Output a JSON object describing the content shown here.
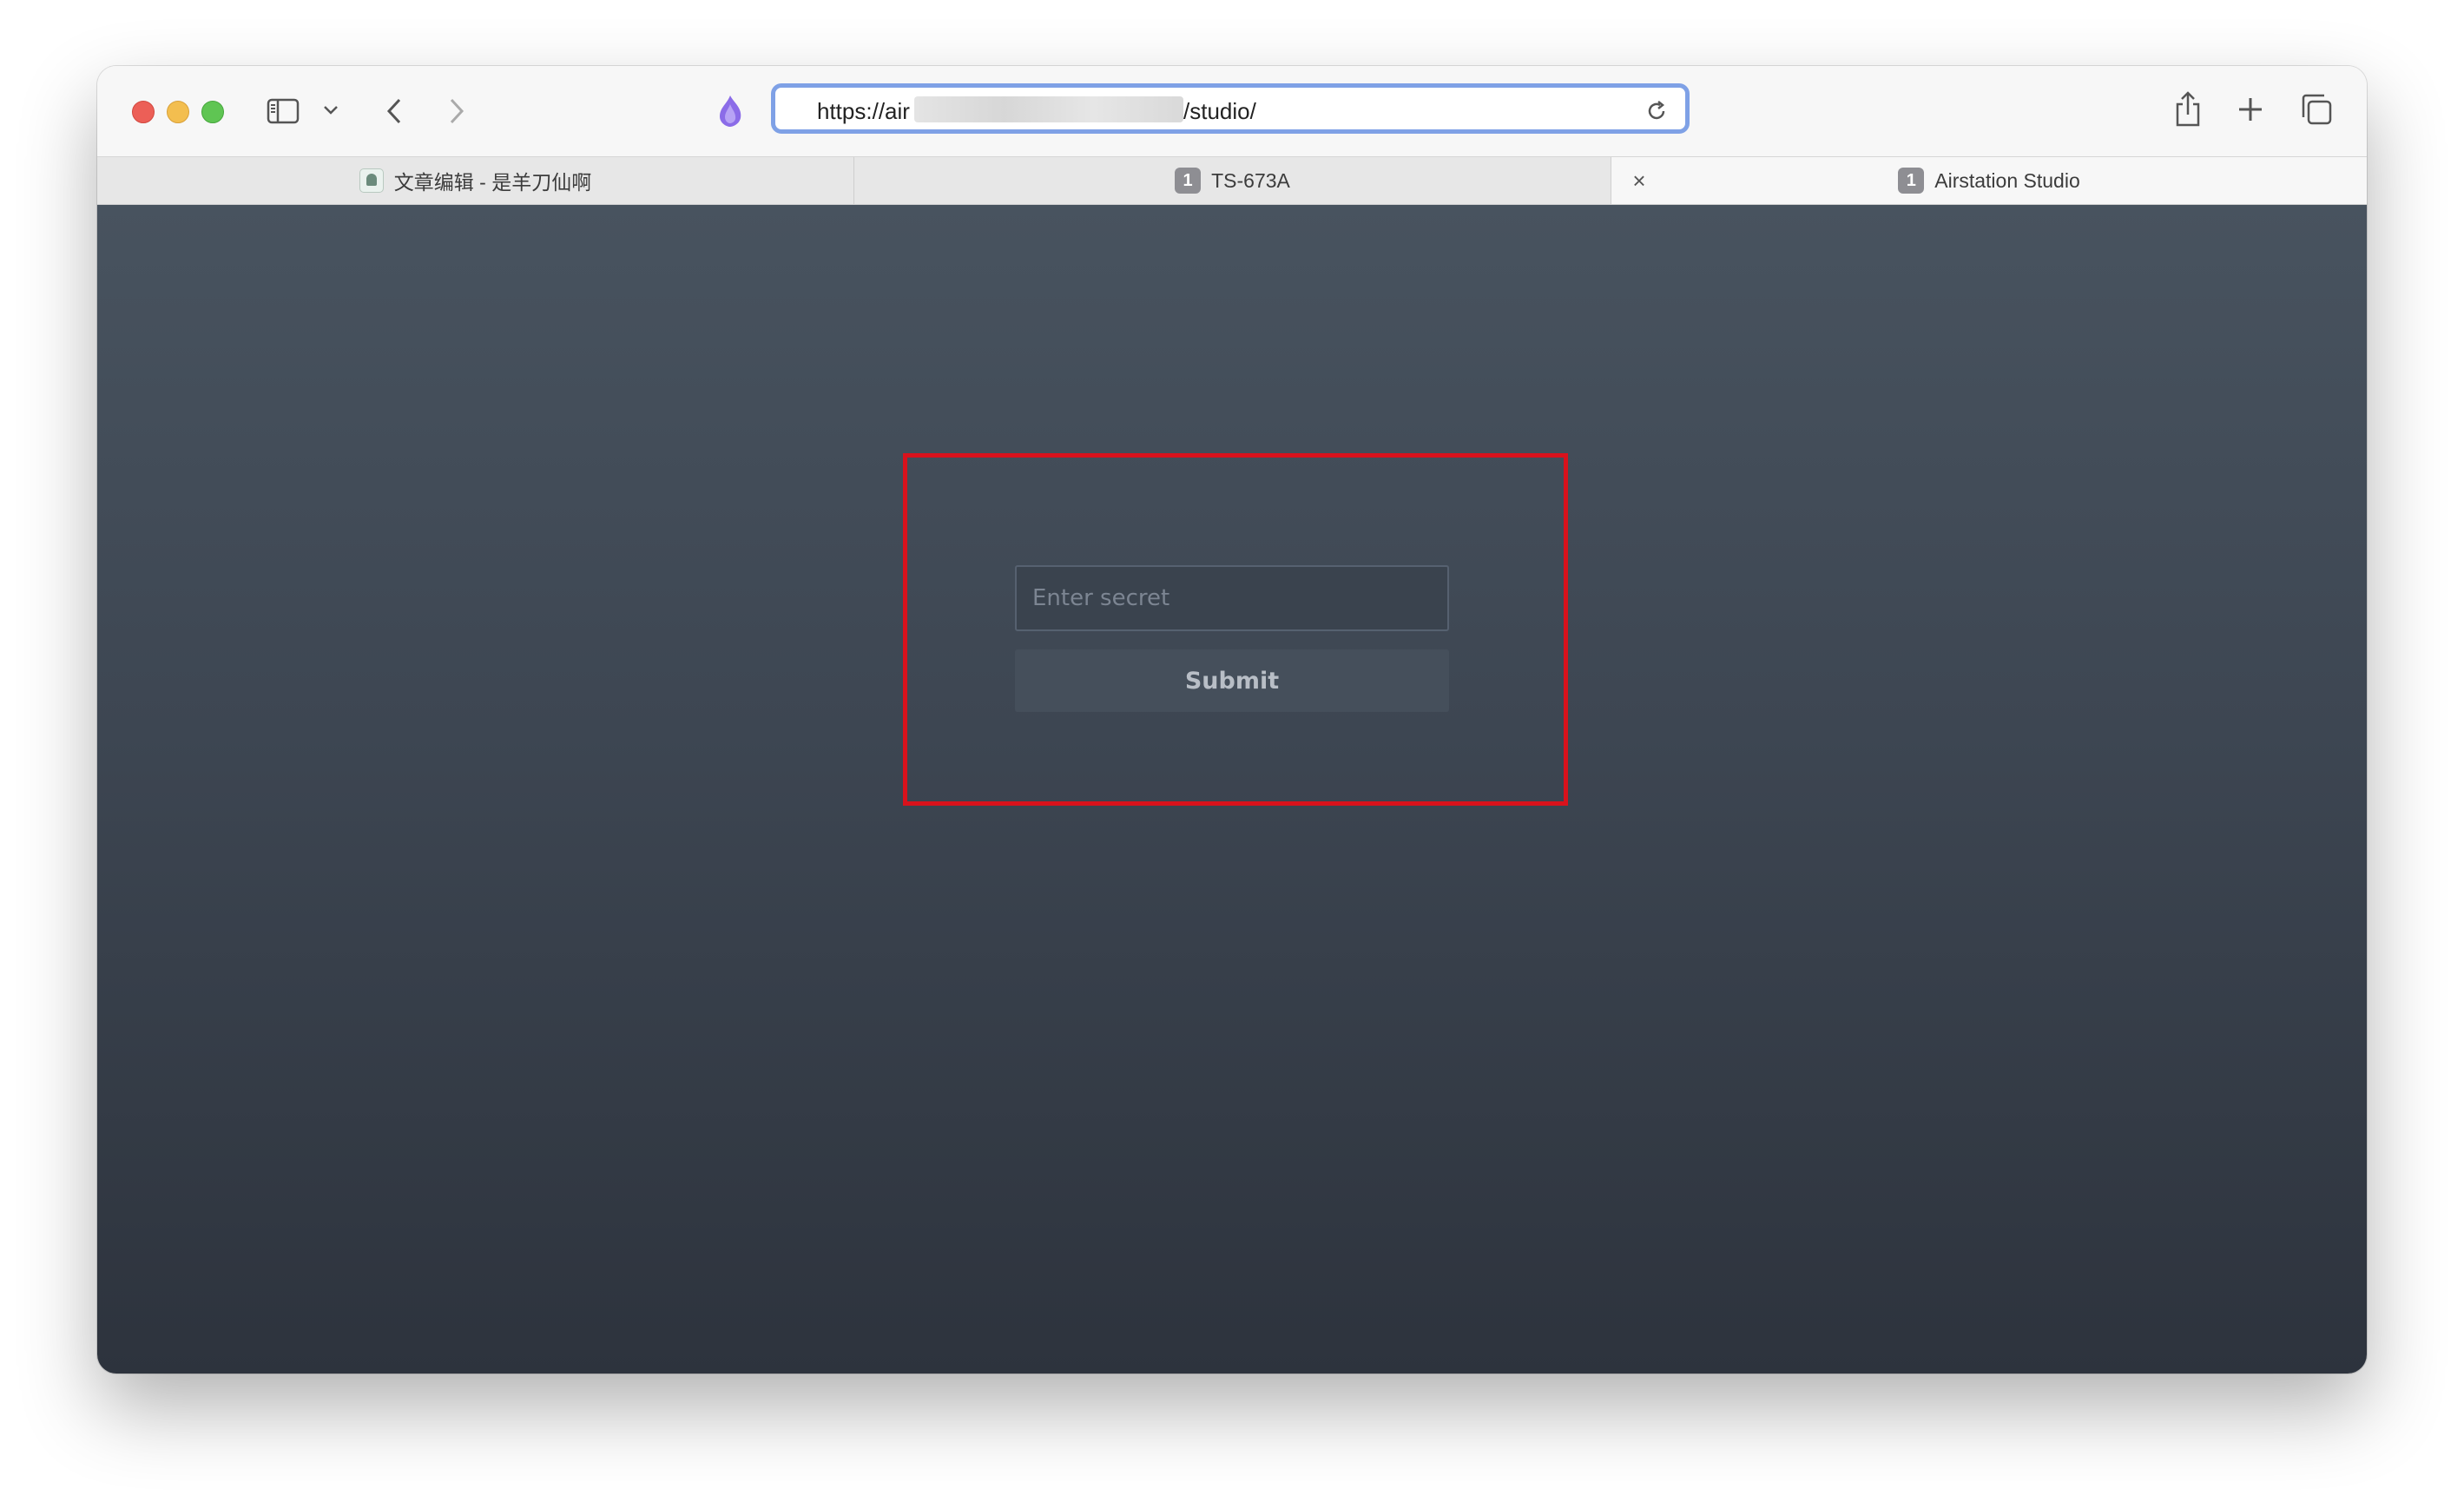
{
  "browser": {
    "url_prefix": "https://air",
    "url_suffix": "/studio/",
    "icons": {
      "sidebar": "sidebar-icon",
      "chevron": "chevron-down-icon",
      "back": "back-icon",
      "forward": "forward-icon",
      "extension": "extension-icon",
      "reload": "reload-icon",
      "share": "share-icon",
      "new_tab": "plus-icon",
      "tab_overview": "tab-overview-icon"
    }
  },
  "tabs": [
    {
      "label": "文章编辑 - 是羊刀仙啊",
      "icon": "favicon-icon"
    },
    {
      "label": "TS-673A",
      "badge": "1"
    },
    {
      "label": "Airstation Studio",
      "badge": "1",
      "active": true,
      "close_icon": "close-icon"
    }
  ],
  "page": {
    "secret_placeholder": "Enter secret",
    "submit_label": "Submit",
    "highlight_color": "#d9121c",
    "background_top": "#48535f",
    "background_bottom": "#2d333d"
  }
}
